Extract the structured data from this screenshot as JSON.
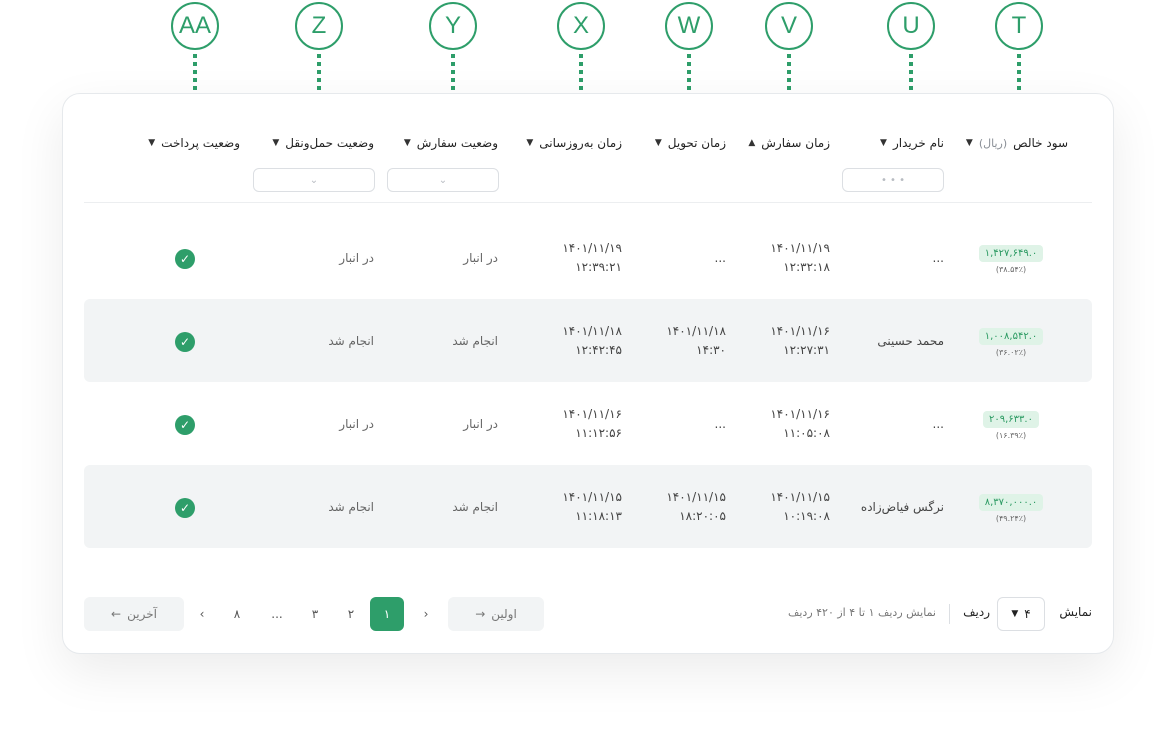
{
  "markers": [
    "AA",
    "Z",
    "Y",
    "X",
    "W",
    "V",
    "U",
    "T"
  ],
  "columns": {
    "profit": {
      "label": "سود خالص",
      "unit": "(ریال)"
    },
    "buyer": {
      "label": "نام خریدار"
    },
    "order_time": {
      "label": "زمان سفارش"
    },
    "delivery_time": {
      "label": "زمان تحویل"
    },
    "update_time": {
      "label": "زمان به‌روزسانی"
    },
    "order_status": {
      "label": "وضعیت سفارش"
    },
    "shipping_status": {
      "label": "وضعیت حمل‌ونقل"
    },
    "payment_status": {
      "label": "وضعیت پرداخت"
    }
  },
  "filters": {
    "buyer_placeholder": "• • •",
    "dropdown_icon": "chevron-down-icon"
  },
  "rows": [
    {
      "profit": "۱,۴۲۷,۶۴۹.۰",
      "profit_pct": "(۳۸.۵۴٪)",
      "buyer": "...",
      "order_date": "۱۴۰۱/۱۱/۱۹",
      "order_clock": "۱۲:۳۲:۱۸",
      "delivery_date": "...",
      "delivery_clock": "",
      "update_date": "۱۴۰۱/۱۱/۱۹",
      "update_clock": "۱۲:۳۹:۲۱",
      "order_status": "در انبار",
      "shipping_status": "در انبار"
    },
    {
      "profit": "۱,۰۰۸,۵۴۲.۰",
      "profit_pct": "(۳۶.۰۲٪)",
      "buyer": "محمد حسینی",
      "order_date": "۱۴۰۱/۱۱/۱۶",
      "order_clock": "۱۲:۲۷:۳۱",
      "delivery_date": "۱۴۰۱/۱۱/۱۸",
      "delivery_clock": "۱۴:۳۰",
      "update_date": "۱۴۰۱/۱۱/۱۸",
      "update_clock": "۱۲:۴۲:۴۵",
      "order_status": "انجام شد",
      "shipping_status": "انجام شد"
    },
    {
      "profit": "۲۰۹,۶۳۳.۰",
      "profit_pct": "(۱۶.۳۹٪)",
      "buyer": "...",
      "order_date": "۱۴۰۱/۱۱/۱۶",
      "order_clock": "۱۱:۰۵:۰۸",
      "delivery_date": "...",
      "delivery_clock": "",
      "update_date": "۱۴۰۱/۱۱/۱۶",
      "update_clock": "۱۱:۱۲:۵۶",
      "order_status": "در انبار",
      "shipping_status": "در انبار"
    },
    {
      "profit": "۸,۳۷۰,۰۰۰.۰",
      "profit_pct": "(۴۹.۲۴٪)",
      "buyer": "نرگس فیاض‌زاده",
      "order_date": "۱۴۰۱/۱۱/۱۵",
      "order_clock": "۱۰:۱۹:۰۸",
      "delivery_date": "۱۴۰۱/۱۱/۱۵",
      "delivery_clock": "۱۸:۲۰:۰۵",
      "update_date": "۱۴۰۱/۱۱/۱۵",
      "update_clock": "۱۱:۱۸:۱۳",
      "order_status": "انجام شد",
      "shipping_status": "انجام شد"
    }
  ],
  "footer": {
    "show_label": "نمایش",
    "rows_value": "۴",
    "rows_label": "ردیف",
    "summary": "نمایش ردیف ۱ تا ۴ از ۴۲۰ ردیف",
    "first_label": "اولین",
    "last_label": "آخرین",
    "pages": [
      "۱",
      "۲",
      "۳",
      "...",
      "۸"
    ],
    "prev_glyph": "‹",
    "next_glyph": "›"
  },
  "colors": {
    "accent": "#2e9e6a",
    "badge_bg": "#dff3e7",
    "row_shade": "#f2f4f5"
  }
}
